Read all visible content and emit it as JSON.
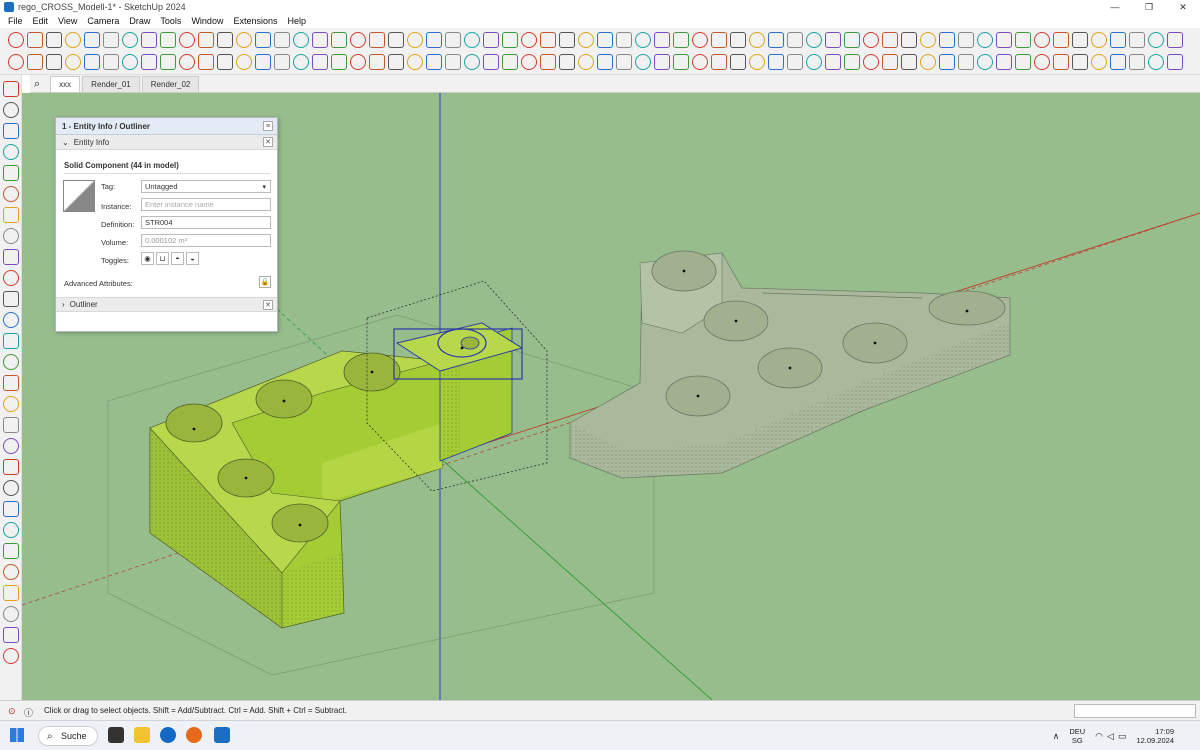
{
  "window": {
    "title": "rego_CROSS_Modell-1* - SketchUp 2024",
    "controls": [
      "—",
      "❐",
      "✕"
    ]
  },
  "menu": [
    "File",
    "Edit",
    "View",
    "Camera",
    "Draw",
    "Tools",
    "Window",
    "Extensions",
    "Help"
  ],
  "tabs": [
    "xxx",
    "Render_01",
    "Render_02"
  ],
  "panel": {
    "title": "1 - Entity Info / Outliner",
    "entity_info_label": "Entity Info",
    "heading": "Solid Component (44 in model)",
    "tag_label": "Tag:",
    "tag_value": "Untagged",
    "instance_label": "Instance:",
    "instance_placeholder": "Enter instance name",
    "definition_label": "Definition:",
    "definition_value": "STR004",
    "volume_label": "Volume:",
    "volume_value": "0.000102 m³",
    "toggles_label": "Toggles:",
    "advanced_label": "Advanced Attributes:",
    "outliner_label": "Outliner"
  },
  "status": {
    "text": "Click or drag to select objects. Shift = Add/Subtract. Ctrl = Add. Shift + Ctrl = Subtract."
  },
  "taskbar": {
    "search": "Suche",
    "lang": "DEU",
    "region": "SG",
    "time": "17:09",
    "date": "12.09.2024"
  },
  "colors": {
    "viewport": "#97bd8d",
    "selected_part": "#a4cc34",
    "ghost_part": "#a9b99c",
    "red_axis": "#c0392b",
    "blue_axis": "#2c3fd1",
    "green_axis": "#2d9e3a"
  }
}
